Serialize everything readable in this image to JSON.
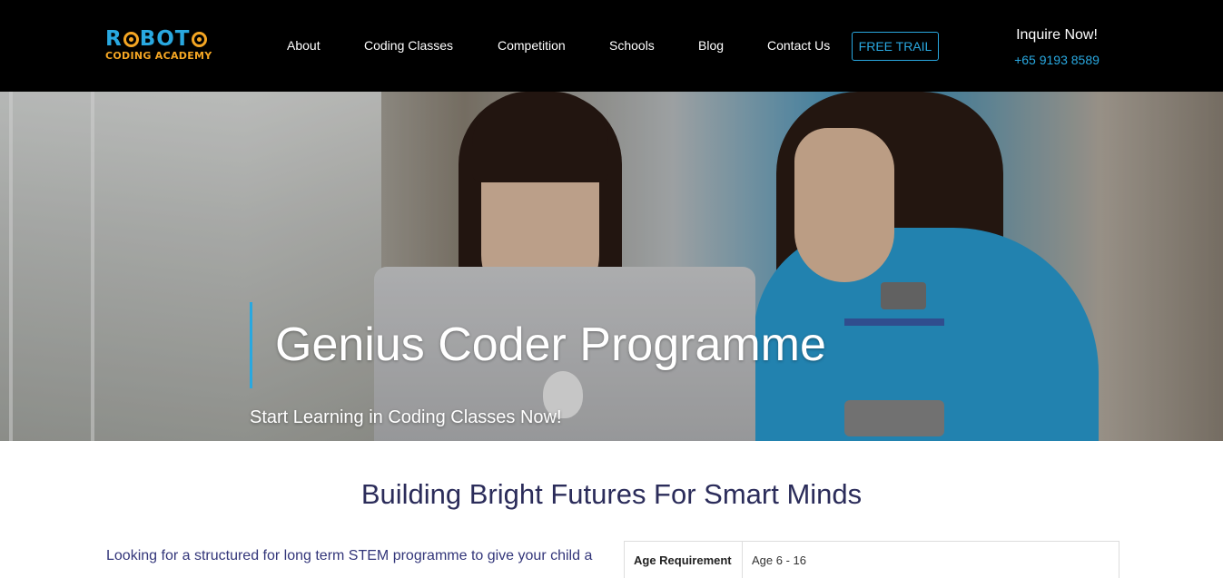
{
  "header": {
    "logo": {
      "line1": "ROBOTO",
      "line2": "CODING ACADEMY"
    },
    "nav": [
      {
        "label": "About"
      },
      {
        "label": "Coding Classes"
      },
      {
        "label": "Competition"
      },
      {
        "label": "Schools"
      },
      {
        "label": "Blog"
      },
      {
        "label": "Contact Us"
      }
    ],
    "cta_label": "FREE TRAIL",
    "inquire_label": "Inquire Now!",
    "phone": "+65 9193 8589"
  },
  "hero": {
    "title": "Genius Coder Programme",
    "subtitle": "Start Learning in Coding Classes Now!"
  },
  "main": {
    "section_title": "Building Bright Futures For Smart Minds",
    "intro": "Looking for a structured for long term STEM programme to give your child a",
    "info_table": [
      {
        "label": "Age Requirement",
        "value": "Age 6 - 16"
      }
    ]
  },
  "colors": {
    "accent": "#29a8e0",
    "logo_orange": "#f5a623",
    "header_bg": "#000000",
    "heading": "#2b2c5a"
  }
}
